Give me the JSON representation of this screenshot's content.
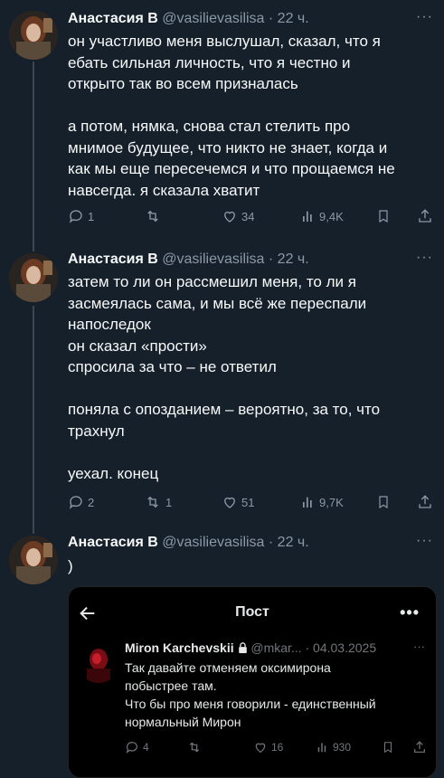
{
  "colors": {
    "background": "#15202b",
    "text": "#f7f9f9",
    "muted": "#8b98a5",
    "thread_line": "#3a4753",
    "embedded_background": "#000000"
  },
  "tweets": [
    {
      "author_name": "Анастасия В",
      "author_handle": "@vasilievasilisa",
      "time": "· 22 ч.",
      "more": "···",
      "paragraphs": [
        [
          "он участливо меня выслушал, сказал, что я",
          "ебать сильная личность, что я честно и",
          "открыто так во всем призналась"
        ],
        [
          "а потом, нямка, снова стал стелить про",
          "мнимое будущее, что никто не знает, когда и",
          "как мы еще пересечемся и что прощаемся не",
          "навсегда. я сказала хватит"
        ]
      ],
      "stats": {
        "replies": "1",
        "reposts": "",
        "likes": "34",
        "views": "9,4K"
      }
    },
    {
      "author_name": "Анастасия В",
      "author_handle": "@vasilievasilisa",
      "time": "· 22 ч.",
      "more": "···",
      "paragraphs": [
        [
          "затем то ли он рассмешил меня, то ли я",
          "засмеялась сама, и мы всё же переспали",
          "напоследок",
          "он сказал «прости»",
          "спросила за что – не ответил"
        ],
        [
          "поняла с опозданием – вероятно, за то, что",
          "трахнул"
        ],
        [
          "уехал. конец"
        ]
      ],
      "stats": {
        "replies": "2",
        "reposts": "1",
        "likes": "51",
        "views": "9,7K"
      }
    },
    {
      "author_name": "Анастасия В",
      "author_handle": "@vasilievasilisa",
      "time": "· 22 ч.",
      "more": "···",
      "paragraphs": [
        [
          ")"
        ]
      ]
    }
  ],
  "embedded": {
    "header_title": "Пост",
    "header_more": "•••",
    "author_name": "Miron Karchevskii",
    "author_handle": "@mkar...",
    "date": "· 04.03.2025",
    "more": "···",
    "lines": [
      "Так давайте отменяем оксимирона",
      "побыстрее там.",
      "Что бы про меня говорили - единственный",
      "нормальный Мирон"
    ],
    "stats": {
      "replies": "4",
      "reposts": "",
      "likes": "16",
      "views": "930"
    }
  }
}
